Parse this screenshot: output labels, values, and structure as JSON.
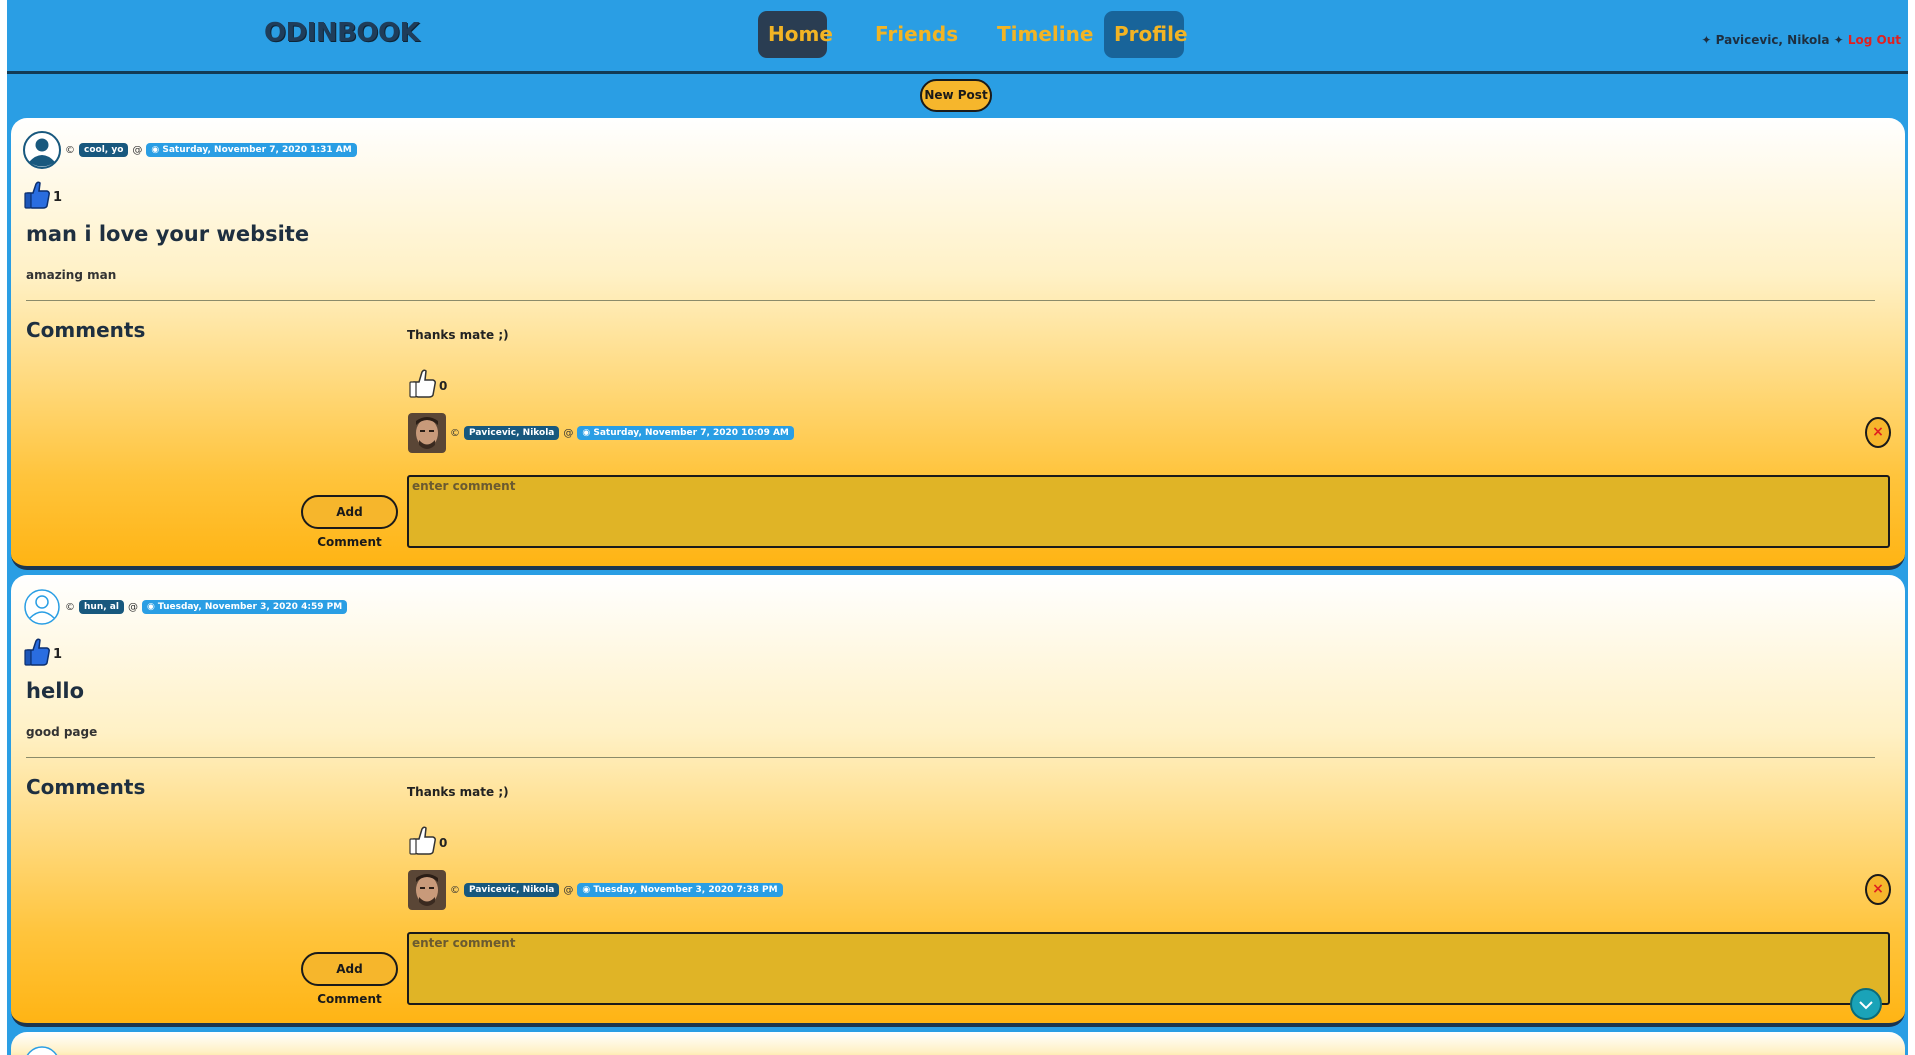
{
  "nav": {
    "brand": "ODINBOOK",
    "items": [
      "Home",
      "Friends",
      "Timeline",
      "Profile"
    ],
    "user_prefix": "✦ ",
    "user_name": "Pavicevic, Nikola",
    "user_suffix": " ✦ ",
    "logout_label": "Log Out"
  },
  "new_post_label": "New Post",
  "posts": [
    {
      "separator": "@",
      "author": "cool, yo",
      "date": "◉ Saturday, November 7, 2020 1:31 AM",
      "likes": "1",
      "title": "man i love your website",
      "body": "amazing man",
      "comments_heading": "Comments",
      "comment": {
        "text": "Thanks mate ;)",
        "likes": "0",
        "author": "Pavicevic, Nikola",
        "date": "◉ Saturday, November 7, 2020 10:09 AM",
        "delete_label": "×"
      },
      "add_comment_label": "Add Comment",
      "comment_placeholder": "enter comment"
    },
    {
      "separator": "@",
      "author": "hun, al",
      "date": "◉ Tuesday, November 3, 2020 4:59 PM",
      "likes": "1",
      "title": "hello",
      "body": "good page",
      "comments_heading": "Comments",
      "comment": {
        "text": "Thanks mate ;)",
        "likes": "0",
        "author": "Pavicevic, Nikola",
        "date": "◉ Tuesday, November 3, 2020 7:38 PM",
        "delete_label": "×"
      },
      "add_comment_label": "Add Comment",
      "comment_placeholder": "enter comment"
    }
  ],
  "icons": {
    "avatar_default": "user-avatar-icon",
    "like_filled": "thumbs-up-filled-icon",
    "like_outline": "thumbs-up-outline-icon",
    "scroll": "chevron-down-icon"
  },
  "colors": {
    "header_bg": "#2a9ee4",
    "accent_gold": "#f2b424",
    "dark_tag": "#18587e",
    "logout_red": "#e02020"
  }
}
